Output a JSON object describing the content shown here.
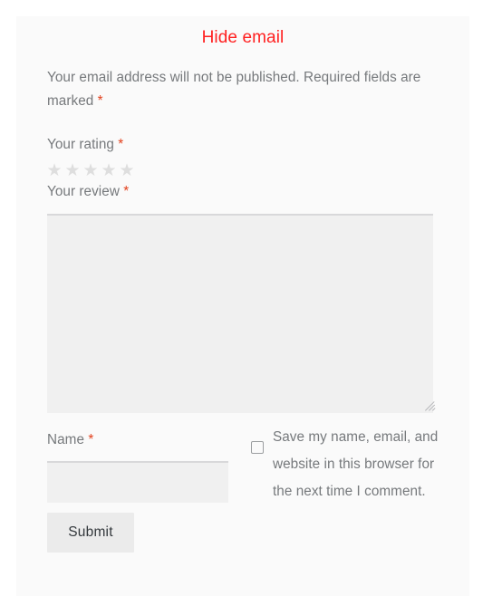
{
  "form": {
    "title": "Hide email",
    "notice_text": "Your email address will not be published. Required fields are marked ",
    "required_marker": "*",
    "rating": {
      "label": "Your rating ",
      "required_marker": "*",
      "star_glyph": "★",
      "star_count": 5,
      "selected": 0,
      "star_color": "#dedede"
    },
    "review": {
      "label": "Your review ",
      "required_marker": "*",
      "value": "",
      "placeholder": ""
    },
    "name": {
      "label": "Name ",
      "required_marker": "*",
      "value": "",
      "placeholder": ""
    },
    "consent": {
      "label": "Save my name, email, and website in this browser for the next time I comment.",
      "checked": false
    },
    "submit_label": "Submit",
    "colors": {
      "title": "#ff2020",
      "required": "#e2401c",
      "body_text": "#76797c",
      "card_bg": "#fafafa",
      "field_bg": "#f0f0f0",
      "button_bg": "#ebebeb"
    }
  }
}
